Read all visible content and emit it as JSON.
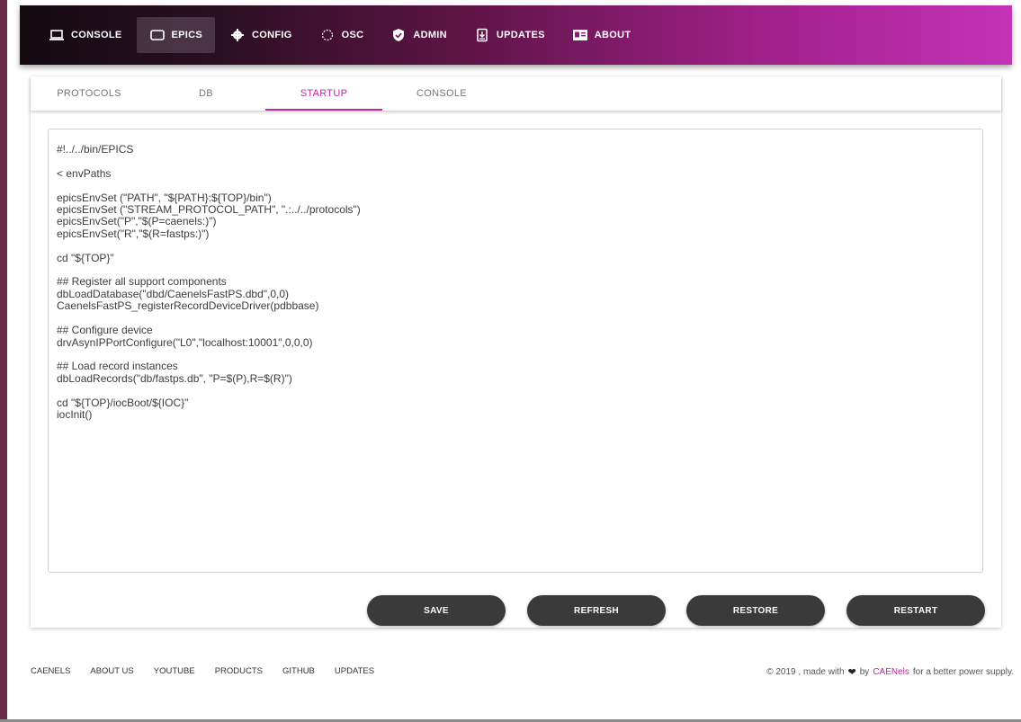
{
  "navbar": {
    "items": [
      {
        "label": "CONSOLE",
        "icon": "laptop-icon"
      },
      {
        "label": "EPICS",
        "icon": "tablet-icon",
        "active": true
      },
      {
        "label": "CONFIG",
        "icon": "gear-icon"
      },
      {
        "label": "OSC",
        "icon": "oscilloscope-icon"
      },
      {
        "label": "ADMIN",
        "icon": "shield-icon"
      },
      {
        "label": "UPDATES",
        "icon": "download-icon"
      },
      {
        "label": "ABOUT",
        "icon": "contact-card-icon"
      }
    ]
  },
  "tabs": [
    {
      "label": "PROTOCOLS"
    },
    {
      "label": "DB"
    },
    {
      "label": "STARTUP",
      "active": true
    },
    {
      "label": "CONSOLE"
    }
  ],
  "editor": {
    "content": "#!../../bin/EPICS\n\n< envPaths\n\nepicsEnvSet (\"PATH\", \"${PATH}:${TOP}/bin\")\nepicsEnvSet (\"STREAM_PROTOCOL_PATH\", \".:../../protocols\")\nepicsEnvSet(\"P\",\"$(P=caenels:)\")\nepicsEnvSet(\"R\",\"$(R=fastps:)\")\n\ncd \"${TOP}\"\n\n## Register all support components\ndbLoadDatabase(\"dbd/CaenelsFastPS.dbd\",0,0)\nCaenelsFastPS_registerRecordDeviceDriver(pdbbase)\n\n## Configure device\ndrvAsynIPPortConfigure(\"L0\",\"localhost:10001\",0,0,0)\n\n## Load record instances\ndbLoadRecords(\"db/fastps.db\", \"P=$(P),R=$(R)\")\n\ncd \"${TOP}/iocBoot/${IOC}\"\niocInit()"
  },
  "buttons": {
    "save": "SAVE",
    "refresh": "REFRESH",
    "restore": "RESTORE",
    "restart": "RESTART"
  },
  "footer": {
    "links": [
      "CAENELS",
      "ABOUT US",
      "YOUTUBE",
      "PRODUCTS",
      "GITHUB",
      "UPDATES"
    ],
    "copyright_prefix": "© 2019 , made with",
    "by": "by",
    "brand": "CAENels",
    "suffix": "for a better power supply."
  },
  "colors": {
    "accent": "#c2279f",
    "button": "#3a3a3a"
  }
}
